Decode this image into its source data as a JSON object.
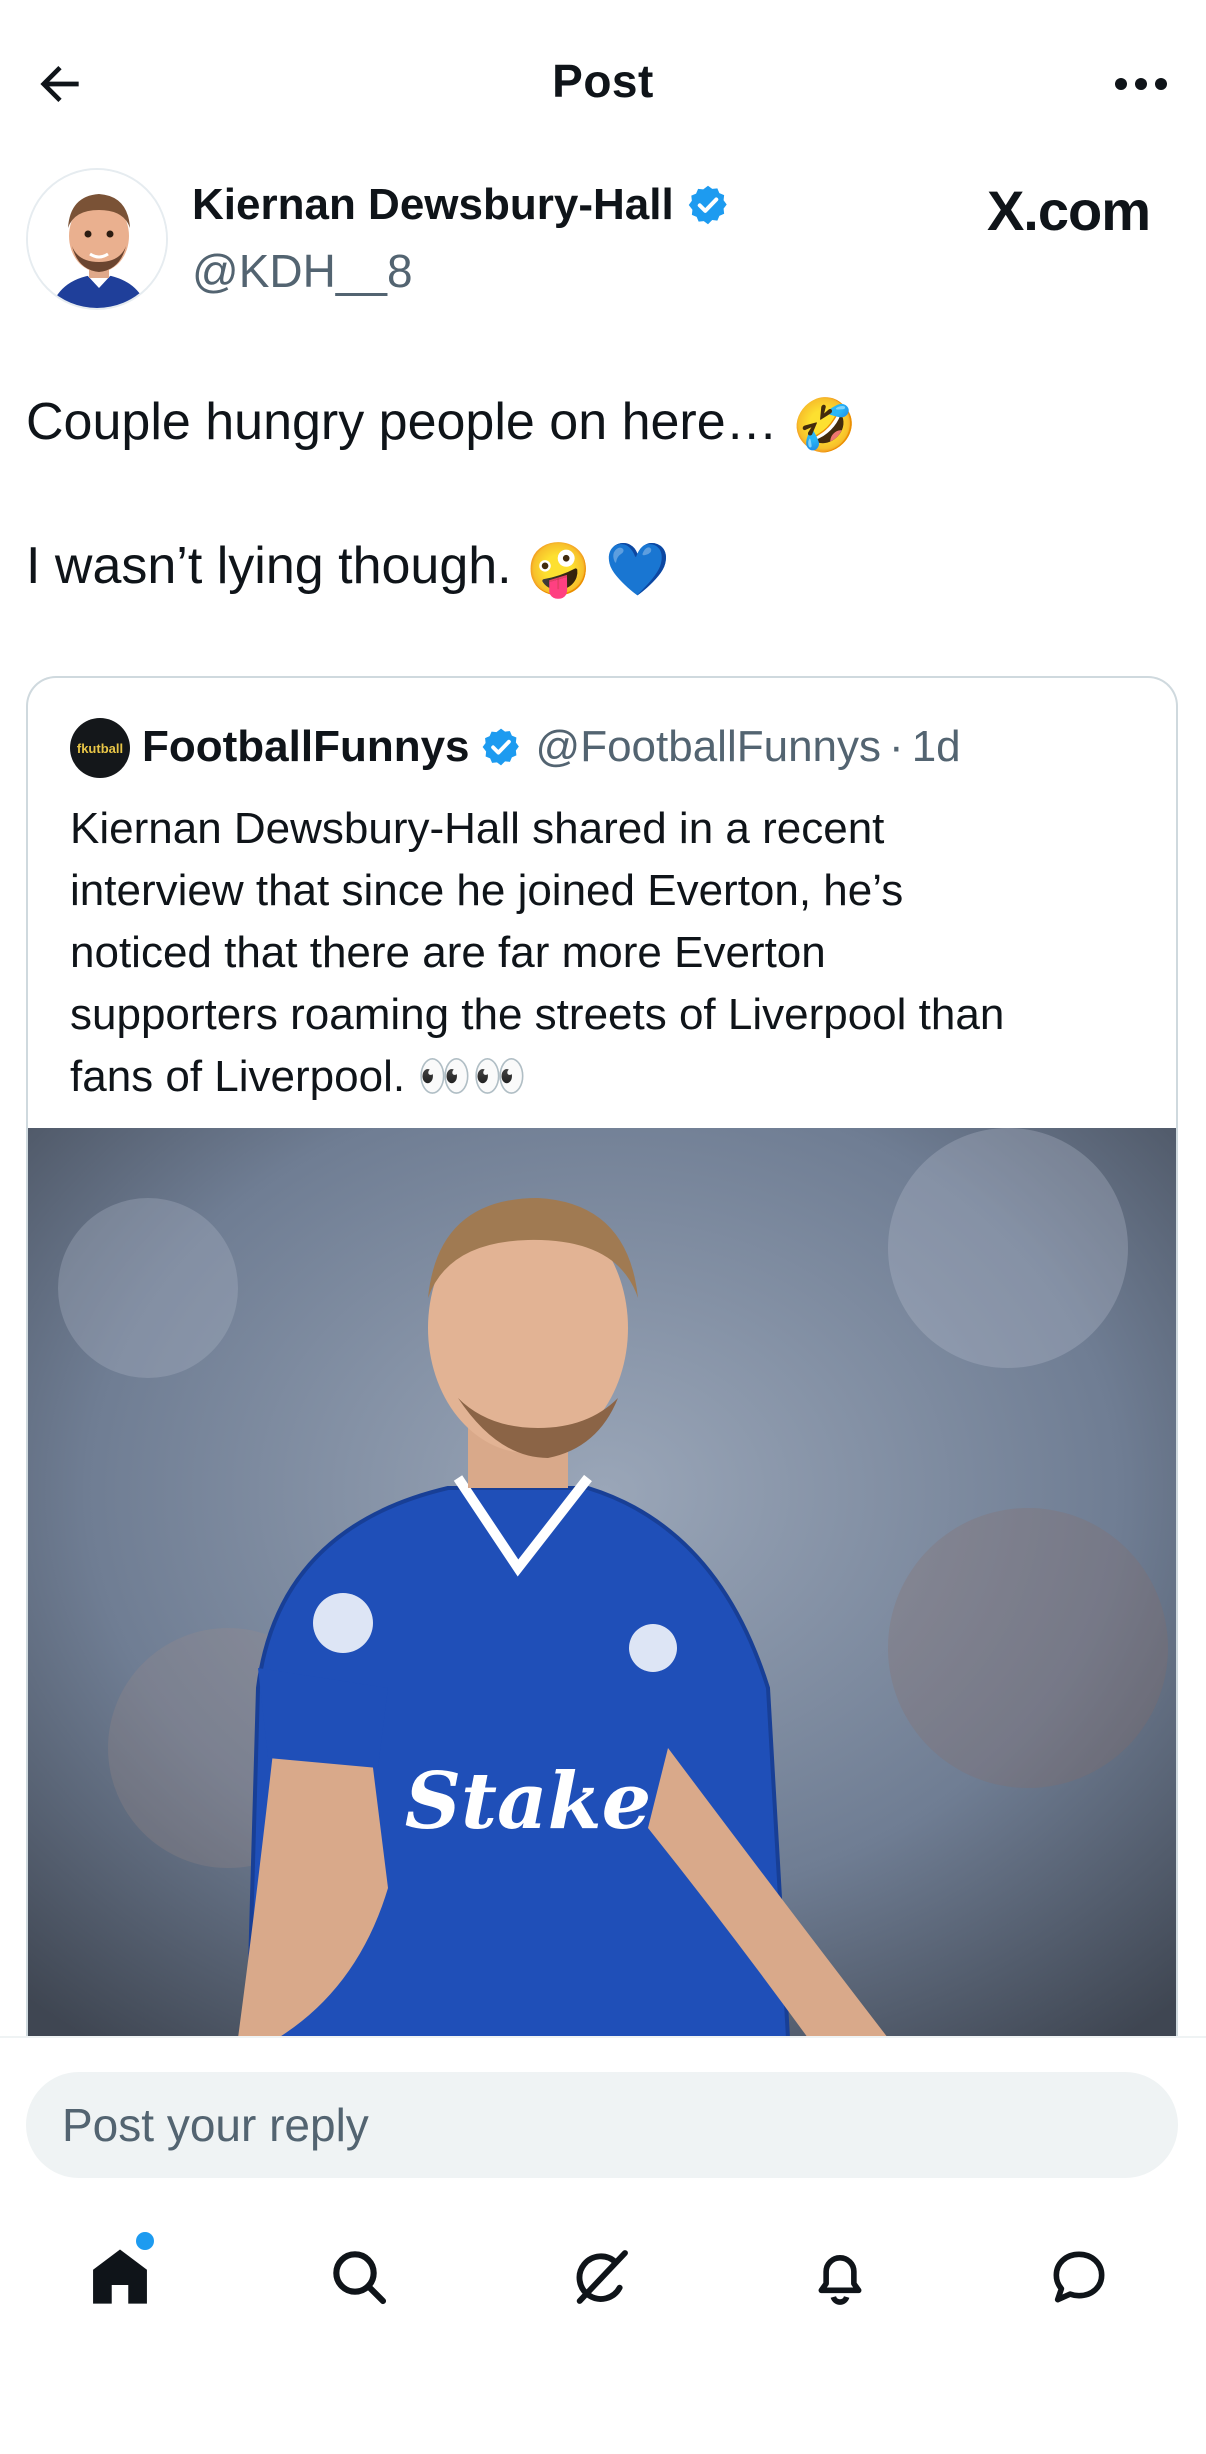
{
  "header": {
    "title": "Post",
    "back_icon": "arrow-left-icon",
    "more_icon": "more-horizontal-icon"
  },
  "author": {
    "name": "Kiernan Dewsbury-Hall",
    "handle": "@KDH__8",
    "verified": true,
    "watermark": "X.com"
  },
  "post": {
    "line1": "Couple hungry people on here…",
    "line1_emoji": "🤣",
    "line2": "I wasn’t lying though.",
    "line2_emoji1": "🤪",
    "line2_emoji2": "💙"
  },
  "quote": {
    "avatar_text": "fkutball",
    "name": "FootballFunnys",
    "verified": true,
    "handle": "@FootballFunnys",
    "separator": "·",
    "time": "1d",
    "lines": [
      "Kiernan Dewsbury-Hall shared in a recent",
      "interview that since he joined Everton, he’s",
      "noticed that there are far more Everton",
      "supporters roaming the streets of Liverpool than",
      "fans of Liverpool. 👀👀"
    ],
    "image_desc_icon": "photo-player-icon",
    "shirt_sponsor": "Stake"
  },
  "reply": {
    "placeholder": "Post your reply"
  },
  "nav": {
    "items": [
      "home-icon",
      "search-icon",
      "grok-icon",
      "notifications-icon",
      "messages-icon"
    ],
    "home_badge": true
  },
  "colors": {
    "accent": "#1d9bf0",
    "text": "#0f1419",
    "secondary": "#536471",
    "border": "#cfd9de",
    "everton_blue": "#1f4fb8"
  }
}
